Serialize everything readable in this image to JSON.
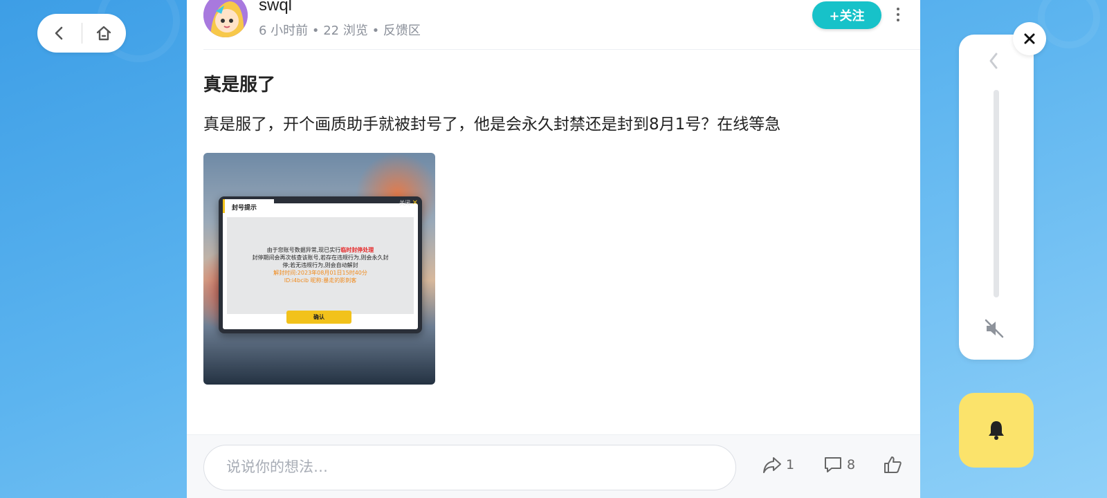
{
  "nav": {
    "back_icon": "chevron-left-icon",
    "home_icon": "home-icon"
  },
  "post": {
    "author": "swql",
    "meta": "6 小时前 • 22 浏览 • 反馈区",
    "follow_label": "+关注",
    "title": "真是服了",
    "body": "真是服了，开个画质助手就被封号了，他是会永久封禁还是封到8月1号？在线等急"
  },
  "image_dialog": {
    "tab_label": "封号提示",
    "close_label": "关闭",
    "line1_prefix": "由于您账号数据异常,现已实行",
    "line1_highlight": "临时封停处理",
    "line2": "封停期间会再次核查该账号,若存在违规行为,则会永久封",
    "line3": "停;若无违规行为,则会自动解封",
    "line4": "解封时间:2023年08月01日15时40分",
    "line5": "ID:i4bcib 昵称:暴走的影刺客",
    "confirm_label": "确认"
  },
  "bottom_bar": {
    "comment_placeholder": "说说你的想法…",
    "share_count": "1",
    "comment_count": "8"
  },
  "colors": {
    "accent": "#17c2c9",
    "bell_bg": "#fbe36b",
    "highlight_red": "#e52b2b",
    "highlight_orange": "#f08a1c"
  }
}
